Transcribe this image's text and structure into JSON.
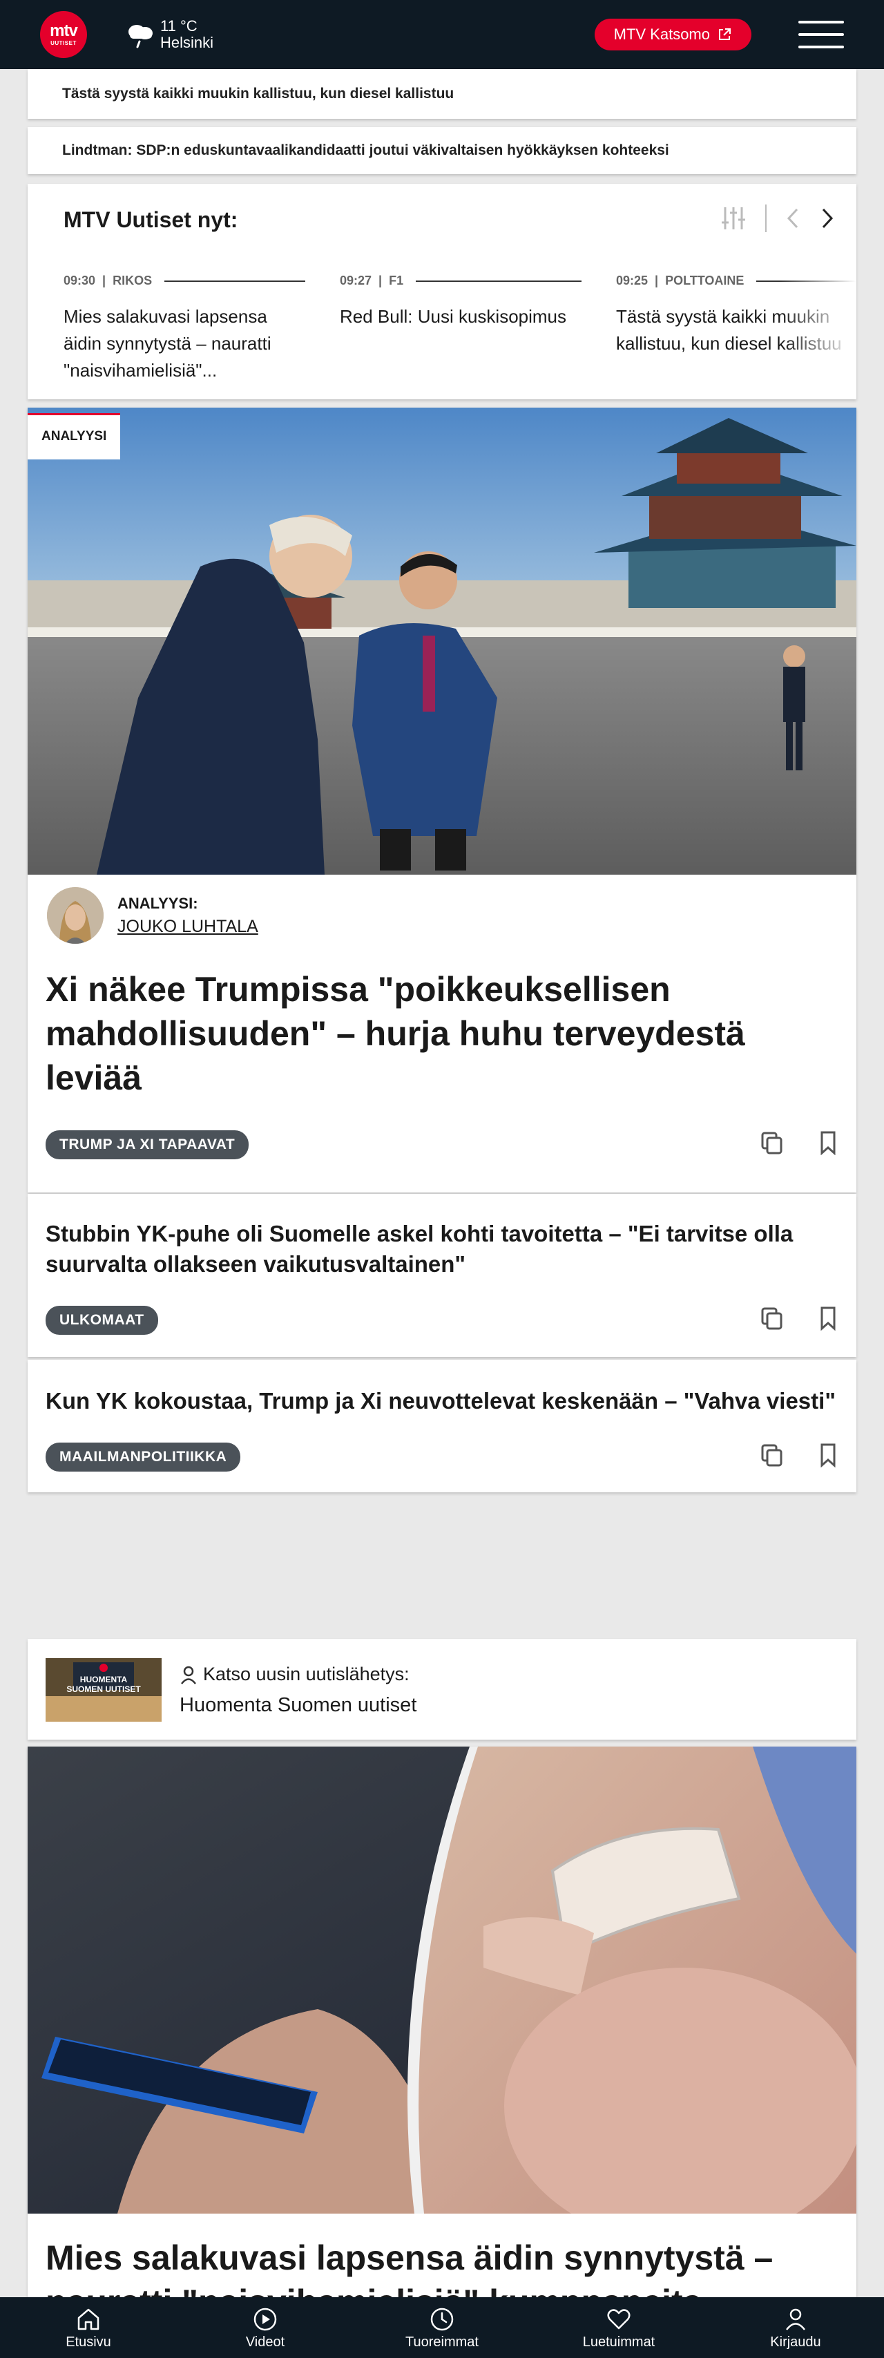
{
  "header": {
    "logo_top": "mtv",
    "logo_bottom": "UUTISET",
    "weather_temp": "11 °C",
    "weather_city": "Helsinki",
    "katsomo_label": "MTV Katsomo"
  },
  "headline_strips": [
    "Tästä syystä kaikki muukin kallistuu, kun diesel kallistuu",
    "Lindtman: SDP:n eduskuntavaalikandidaatti joutui väkivaltaisen hyökkäyksen kohteeksi"
  ],
  "now": {
    "title": "MTV Uutiset nyt:",
    "items": [
      {
        "time": "09:30",
        "category": "RIKOS",
        "text": "Mies salakuvasi lapsensa äidin synnytystä – nauratti \"naisvihamielisiä\"..."
      },
      {
        "time": "09:27",
        "category": "F1",
        "text": "Red Bull: Uusi kuskisopimus"
      },
      {
        "time": "09:25",
        "category": "POLTTOAINE",
        "text": "Tästä syystä kaikki muukin kallistuu, kun diesel kallistuu"
      }
    ]
  },
  "main_story": {
    "badge": "ANALYYSI",
    "author_label": "ANALYYSI:",
    "author_name": "JOUKO LUHTALA",
    "headline": "Xi näkee Trumpissa \"poikkeuksellisen mahdollisuuden\" – hurja huhu terveydestä leviää",
    "tag": "TRUMP JA XI TAPAAVAT"
  },
  "stories": [
    {
      "headline": "Stubbin YK-puhe oli Suomelle askel kohti tavoitetta – \"Ei tarvitse olla suurvalta ollakseen vaikutusvaltainen\"",
      "tag": "ULKOMAAT"
    },
    {
      "headline": "Kun YK kokoustaa, Trump ja Xi neuvottelevat keskenään – \"Vahva viesti\"",
      "tag": "MAAILMANPOLITIIKKA"
    }
  ],
  "broadcast": {
    "thumb_text": "HUOMENTA SUOMEN UUTISET",
    "label": "Katso uusin uutislähetys:",
    "title": "Huomenta Suomen uutiset"
  },
  "second_story": {
    "headline": "Mies salakuvasi lapsensa äidin synnytystä – nauratti \"naisvihamielisiä\" kumppaneita"
  },
  "bottom_nav": [
    {
      "label": "Etusivu",
      "icon": "home-icon"
    },
    {
      "label": "Videot",
      "icon": "play-icon"
    },
    {
      "label": "Tuoreimmat",
      "icon": "clock-icon"
    },
    {
      "label": "Luetuimmat",
      "icon": "heart-icon"
    },
    {
      "label": "Kirjaudu",
      "icon": "user-icon"
    }
  ],
  "colors": {
    "brand_red": "#e4002b",
    "navy": "#0e1a24",
    "tag_grey": "#4b5259"
  }
}
